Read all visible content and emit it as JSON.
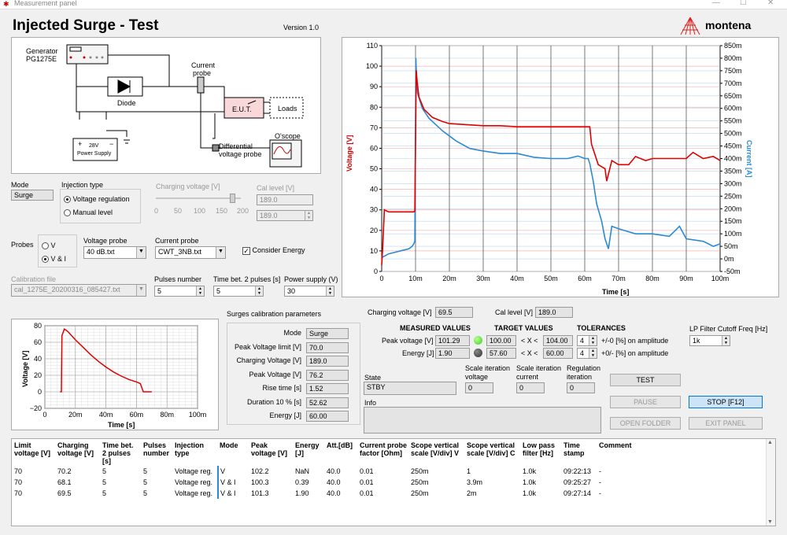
{
  "window": {
    "title": "Measurement panel"
  },
  "header": {
    "title": "Injected Surge - Test",
    "version": "Version 1.0",
    "brand": "montena"
  },
  "diagram": {
    "generator": "Generator",
    "generator_model": "PG1275E",
    "diode": "Diode",
    "current_probe_1": "Current",
    "current_probe_2": "probe",
    "eut": "E.U.T.",
    "loads": "Loads",
    "scope": "O'scope",
    "diff_probe_1": "Differential",
    "diff_probe_2": "voltage probe",
    "psu_1": "28V",
    "psu_2": "Power Supply",
    "plus": "+",
    "minus": "−"
  },
  "settings": {
    "mode_label": "Mode",
    "mode_value": "Surge",
    "injection_label": "Injection type",
    "injection_options": [
      "Voltage regulation",
      "Manual level"
    ],
    "charging_voltage_label": "Charging voltage [V]",
    "slider_ticks": [
      "0",
      "50",
      "100",
      "150",
      "200"
    ],
    "slider_value": 0.9,
    "cal_level_label": "Cal level [V]",
    "cal_level_value": "189.0",
    "cal_level_value2": "189.0",
    "probes_label": "Probes",
    "probes_options": [
      "V",
      "V & I"
    ],
    "voltage_probe_label": "Voltage probe",
    "voltage_probe_value": "40 dB.txt",
    "current_probe_label": "Current probe",
    "current_probe_value": "CWT_3NB.txt",
    "consider_energy_label": "Consider Energy",
    "consider_energy_check": "✓",
    "calibration_file_label": "Calibration file",
    "calibration_file_value": "cal_1275E_20200316_085427.txt",
    "pulses_number_label": "Pulses number",
    "pulses_number_value": "5",
    "time_between_label": "Time bet. 2 pulses [s]",
    "time_between_value": "5",
    "power_supply_label": "Power supply (V)",
    "power_supply_value": "30"
  },
  "main_chart": {
    "ylabel_left": "Voltage [V]",
    "ylabel_right": "Current [A]",
    "xlabel": "Time [s]",
    "y_left_ticks": [
      "110",
      "100",
      "90",
      "80",
      "70",
      "60",
      "50",
      "40",
      "30",
      "20",
      "10",
      "0"
    ],
    "y_right_ticks": [
      "850m",
      "800m",
      "750m",
      "700m",
      "650m",
      "600m",
      "550m",
      "500m",
      "450m",
      "400m",
      "350m",
      "300m",
      "250m",
      "200m",
      "150m",
      "100m",
      "50m",
      "0m",
      "-50m"
    ],
    "x_ticks": [
      "0",
      "10m",
      "20m",
      "30m",
      "40m",
      "50m",
      "60m",
      "70m",
      "80m",
      "90m",
      "100m"
    ],
    "voltage_color": "#e00000",
    "current_color": "#2a8ad4"
  },
  "chart_data": [
    {
      "type": "line",
      "title": "",
      "xlabel": "Time [s]",
      "ylabel": "Voltage [V]",
      "y2label": "Current [A]",
      "xlim": [
        0,
        0.1
      ],
      "ylim": [
        0,
        110
      ],
      "y2lim": [
        -0.05,
        0.85
      ],
      "grid": true,
      "series": [
        {
          "name": "Voltage [V]",
          "axis": "left",
          "x": [
            0,
            0.0003,
            0.0008,
            0.002,
            0.005,
            0.0095,
            0.0098,
            0.01,
            0.0102,
            0.0105,
            0.011,
            0.0125,
            0.015,
            0.018,
            0.02,
            0.025,
            0.03,
            0.035,
            0.04,
            0.045,
            0.05,
            0.055,
            0.06,
            0.0615,
            0.062,
            0.064,
            0.066,
            0.0665,
            0.068,
            0.07,
            0.073,
            0.075,
            0.078,
            0.08,
            0.085,
            0.09,
            0.092,
            0.095,
            0.098,
            0.1
          ],
          "values": [
            3,
            12,
            30,
            29,
            29,
            29,
            29.5,
            65,
            98,
            92,
            85,
            79,
            75,
            73,
            72,
            71.5,
            71,
            71,
            70.5,
            70.5,
            70.5,
            70.5,
            70.5,
            70.5,
            62,
            52,
            50,
            44,
            54,
            52,
            52,
            56,
            54,
            55,
            55,
            55,
            58,
            55,
            56,
            54
          ]
        },
        {
          "name": "Current [A]",
          "axis": "right",
          "x": [
            0,
            0.002,
            0.005,
            0.008,
            0.009,
            0.0095,
            0.0098,
            0.01,
            0.0101,
            0.0103,
            0.0106,
            0.012,
            0.014,
            0.018,
            0.022,
            0.026,
            0.03,
            0.035,
            0.04,
            0.045,
            0.05,
            0.055,
            0.058,
            0.06,
            0.061,
            0.0615,
            0.0625,
            0.0635,
            0.065,
            0.066,
            0.067,
            0.068,
            0.07,
            0.075,
            0.08,
            0.085,
            0.088,
            0.09,
            0.095,
            0.098,
            0.1
          ],
          "values": [
            0.005,
            0.02,
            0.03,
            0.04,
            0.05,
            0.06,
            0.07,
            0.5,
            0.8,
            0.72,
            0.66,
            0.6,
            0.56,
            0.51,
            0.47,
            0.44,
            0.43,
            0.42,
            0.42,
            0.405,
            0.4,
            0.4,
            0.41,
            0.4,
            0.4,
            0.38,
            0.31,
            0.22,
            0.15,
            0.08,
            0.04,
            0.13,
            0.12,
            0.1,
            0.1,
            0.09,
            0.13,
            0.08,
            0.07,
            0.05,
            0.06
          ]
        }
      ]
    },
    {
      "type": "line",
      "title": "",
      "xlabel": "Time [s]",
      "ylabel": "Voltage [V]",
      "xlim": [
        0,
        0.1
      ],
      "ylim": [
        -20,
        80
      ],
      "grid": true,
      "series": [
        {
          "name": "",
          "x": [
            0.01,
            0.0108,
            0.0112,
            0.0128,
            0.015,
            0.02,
            0.025,
            0.03,
            0.035,
            0.04,
            0.045,
            0.05,
            0.055,
            0.06,
            0.0625,
            0.0645,
            0.066,
            0.07
          ],
          "values": [
            0,
            0,
            68,
            76,
            73,
            63,
            54,
            45,
            37,
            30,
            24,
            19,
            15,
            12,
            10,
            0,
            0,
            0
          ]
        }
      ]
    }
  ],
  "preview_chart": {
    "ylabel": "Voltage [V]",
    "xlabel": "Time [s]",
    "y_ticks": [
      "80",
      "60",
      "40",
      "20",
      "0",
      "−20"
    ],
    "x_ticks": [
      "0",
      "20m",
      "40m",
      "60m",
      "80m",
      "100m"
    ]
  },
  "calib": {
    "header": "Surges calibration parameters",
    "rows": [
      {
        "label": "Mode",
        "value": "Surge"
      },
      {
        "label": "Peak Voltage limit [V]",
        "value": "70.0"
      },
      {
        "label": "Charging Voltage [V]",
        "value": "189.0"
      },
      {
        "label": "Peak Voltage [V]",
        "value": "76.2"
      },
      {
        "label": "Rise time [s]",
        "value": "1.52"
      },
      {
        "label": "Duration 10 % [s]",
        "value": "52.62"
      },
      {
        "label": "Energy [J]",
        "value": "60.00"
      }
    ]
  },
  "measure": {
    "charging_voltage_label": "Charging voltage [V]",
    "charging_voltage_value": "69.5",
    "cal_level_label": "Cal level [V]",
    "cal_level_value": "189.0",
    "measured_header": "MEASURED VALUES",
    "target_header": "TARGET VALUES",
    "tolerances_header": "TOLERANCES",
    "peak_label": "Peak voltage [V]",
    "peak_value": "101.29",
    "peak_target_min": "100.00",
    "peak_target_op": "< X <",
    "peak_target_max": "104.00",
    "peak_tol": "4",
    "peak_tol_text": "+/-0 [%] on amplitude",
    "energy_label": "Energy [J]",
    "energy_value": "1.90",
    "energy_target_min": "57.60",
    "energy_target_op": "< X <",
    "energy_target_max": "60.00",
    "energy_tol": "4",
    "energy_tol_text": "+0/- [%] on amplitude",
    "led_ok_color": "#3ccf1c",
    "led_off_color": "#303030",
    "lp_filter_label": "LP Filter Cutoff Freq [Hz]",
    "lp_filter_value": "1k",
    "state_label": "State",
    "state_value": "STBY",
    "scale_voltage_label1": "Scale iteration",
    "scale_voltage_label2": "voltage",
    "scale_voltage_value": "0",
    "scale_current_label1": "Scale iteration",
    "scale_current_label2": "current",
    "scale_current_value": "0",
    "regulation_label1": "Regulation",
    "regulation_label2": "iteration",
    "regulation_value": "0",
    "info_label": "Info",
    "info_value": ""
  },
  "buttons": {
    "test": "TEST",
    "pause": "PAUSE",
    "stop": "STOP [F12]",
    "open_folder": "OPEN FOLDER",
    "exit_panel": "EXIT PANEL"
  },
  "log": {
    "headers": [
      [
        "Limit",
        "voltage [V]"
      ],
      [
        "Charging",
        "voltage [V]"
      ],
      [
        "Time bet.",
        "2 pulses [s]"
      ],
      [
        "Pulses",
        "number"
      ],
      [
        "Injection",
        "type"
      ],
      [
        "Mode",
        ""
      ],
      [
        "Peak",
        "voltage [V]"
      ],
      [
        "Energy",
        "[J]"
      ],
      [
        "Att.[dB]",
        ""
      ],
      [
        "Current probe",
        "factor [Ohm]"
      ],
      [
        "Scope vertical",
        "scale [V/div] V"
      ],
      [
        "Scope vertical",
        "scale [V/div] C"
      ],
      [
        "Low pass",
        "filter [Hz]"
      ],
      [
        "Time",
        "stamp"
      ],
      [
        "Comment",
        ""
      ]
    ],
    "rows": [
      [
        "70",
        "70.2",
        "5",
        "5",
        "Voltage reg.",
        "V",
        "102.2",
        "NaN",
        "40.0",
        "0.01",
        "250m",
        "1",
        "1.0k",
        "09:22:13",
        "-"
      ],
      [
        "70",
        "68.1",
        "5",
        "5",
        "Voltage reg.",
        "V & I",
        "100.3",
        "0.39",
        "40.0",
        "0.01",
        "250m",
        "3.9m",
        "1.0k",
        "09:25:27",
        "-"
      ],
      [
        "70",
        "69.5",
        "5",
        "5",
        "Voltage reg.",
        "V & I",
        "101.3",
        "1.90",
        "40.0",
        "0.01",
        "250m",
        "2m",
        "1.0k",
        "09:27:14",
        "-"
      ]
    ]
  }
}
